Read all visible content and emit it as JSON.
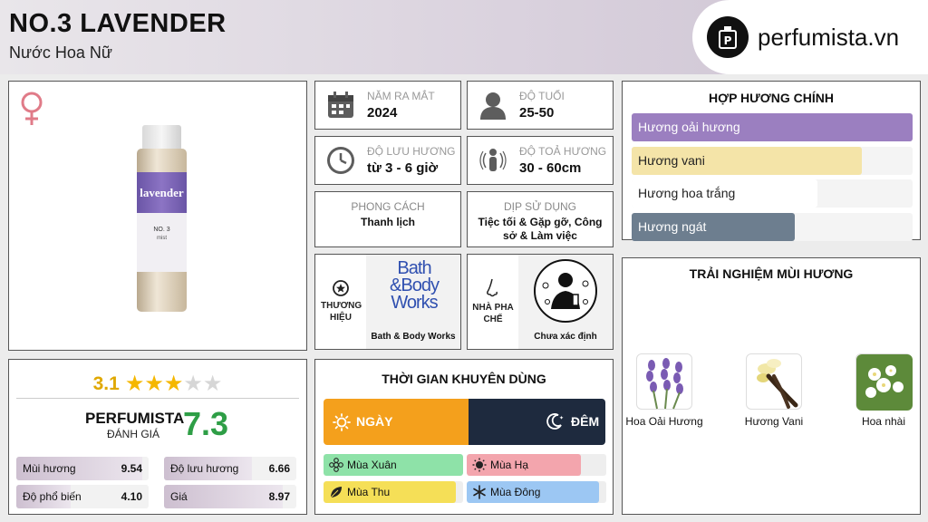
{
  "header": {
    "title": "NO.3 LAVENDER",
    "subtitle": "Nước Hoa Nữ",
    "brand": "perfumista.vn"
  },
  "info": {
    "year_label": "NĂM RA MẮT",
    "year_value": "2024",
    "age_label": "ĐỘ TUỔI",
    "age_value": "25-50",
    "longevity_label": "ĐỘ LƯU HƯƠNG",
    "longevity_value": "từ 3 - 6 giờ",
    "sillage_label": "ĐỘ TOẢ HƯƠNG",
    "sillage_value": "30 - 60cm",
    "style_label": "PHONG CÁCH",
    "style_value": "Thanh lịch",
    "occasion_label": "DỊP SỬ DỤNG",
    "occasion_value": "Tiệc tối & Gặp gỡ, Công sở & Làm việc",
    "brand_label": "THƯƠNG HIỆU",
    "brand_value": "Bath & Body Works",
    "brand_logo_lines": [
      "Bath",
      "&Body",
      "Works"
    ],
    "perfumer_label": "NHÀ PHA CHẾ",
    "perfumer_value": "Chưa xác định"
  },
  "product": {
    "bottle_name": "lavender",
    "bottle_line1": "NO. 3",
    "bottle_line2": "mist"
  },
  "accords": {
    "title": "HỢP HƯƠNG CHÍNH",
    "items": [
      {
        "name": "Hương oải hương",
        "level": 1.0,
        "color": "#9b7fc0",
        "text_color": "#ffffff"
      },
      {
        "name": "Hương vani",
        "level": 0.82,
        "color": "#f4e4a8",
        "text_color": "#222222"
      },
      {
        "name": "Hương hoa trắng",
        "level": 0.66,
        "color": "#ffffff",
        "text_color": "#222222"
      },
      {
        "name": "Hương ngát",
        "level": 0.58,
        "color": "#6d7e8f",
        "text_color": "#ffffff"
      }
    ]
  },
  "experience": {
    "title": "TRẢI NGHIỆM MÙI HƯƠNG",
    "notes": [
      {
        "name": "Hoa Oải Hương",
        "icon": "lavender-icon"
      },
      {
        "name": "Hương Vani",
        "icon": "vanilla-icon"
      },
      {
        "name": "Hoa nhài",
        "icon": "jasmine-icon"
      }
    ]
  },
  "rating": {
    "score": "3.1",
    "stars_filled": 3,
    "stars_total": 5,
    "perfumista_label": "PERFUMISTA",
    "perfumista_sub": "ĐÁNH GIÁ",
    "perfumista_score": "7.3",
    "metrics": [
      {
        "label": "Mùi hương",
        "value": "9.54",
        "level": 0.954
      },
      {
        "label": "Độ lưu hương",
        "value": "6.66",
        "level": 0.666
      },
      {
        "label": "Độ phổ biến",
        "value": "4.10",
        "level": 0.41
      },
      {
        "label": "Giá",
        "value": "8.97",
        "level": 0.897
      }
    ]
  },
  "time": {
    "title": "THỜI GIAN KHUYÊN DÙNG",
    "day_label": "NGÀY",
    "night_label": "ĐÊM",
    "day_color": "#f4a01c",
    "night_color": "#1e2a3e",
    "seasons": [
      {
        "name": "Mùa Xuân",
        "level": 1.0,
        "color": "#8ee2a8",
        "icon": "flower-icon"
      },
      {
        "name": "Mùa Hạ",
        "level": 0.82,
        "color": "#f3a5ad",
        "icon": "sun-icon"
      },
      {
        "name": "Mùa Thu",
        "level": 0.95,
        "color": "#f5df57",
        "icon": "leaf-icon"
      },
      {
        "name": "Mùa Đông",
        "level": 0.95,
        "color": "#9cc7f3",
        "icon": "snowflake-icon"
      }
    ]
  },
  "colors": {
    "female_symbol": "#e07b88",
    "star_filled": "#f5b700",
    "star_empty": "#d6d6d6",
    "score_yellow": "#e0a800",
    "score_green": "#2e9e46"
  }
}
